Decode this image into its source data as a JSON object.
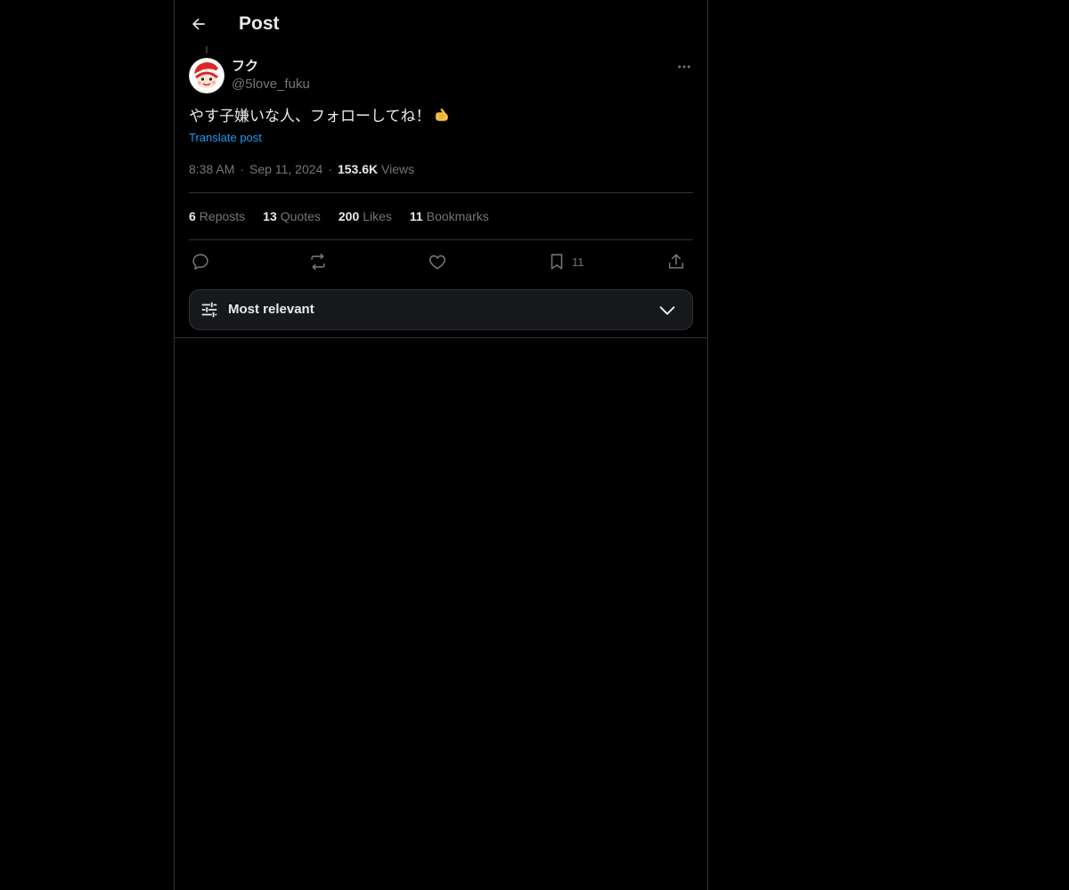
{
  "header": {
    "title": "Post",
    "back_icon": "arrow-left-icon"
  },
  "author": {
    "display_name": "フク",
    "handle": "@5love_fuku",
    "avatar_icon": "santa-face-avatar"
  },
  "post": {
    "text": "やす子嫌いな人、フォローしてね！",
    "emoji": "pointing-hand-emoji",
    "translate_label": "Translate post",
    "time": "8:38 AM",
    "date": "Sep 11, 2024",
    "views_count": "153.6K",
    "views_label": "Views",
    "separator": "·"
  },
  "stats": [
    {
      "count": "6",
      "label": "Reposts"
    },
    {
      "count": "13",
      "label": "Quotes"
    },
    {
      "count": "200",
      "label": "Likes"
    },
    {
      "count": "11",
      "label": "Bookmarks"
    }
  ],
  "actions": {
    "reply_icon": "reply-icon",
    "repost_icon": "repost-icon",
    "like_icon": "heart-icon",
    "bookmark_icon": "bookmark-icon",
    "bookmark_count": "11",
    "share_icon": "share-icon"
  },
  "sort": {
    "label": "Most relevant",
    "icon": "sliders-icon",
    "chevron": "chevron-down-icon"
  },
  "colors": {
    "background": "#000000",
    "text_primary": "#e7e9ea",
    "text_secondary": "#71767b",
    "accent": "#1d9bf0",
    "border": "#2f3336"
  }
}
